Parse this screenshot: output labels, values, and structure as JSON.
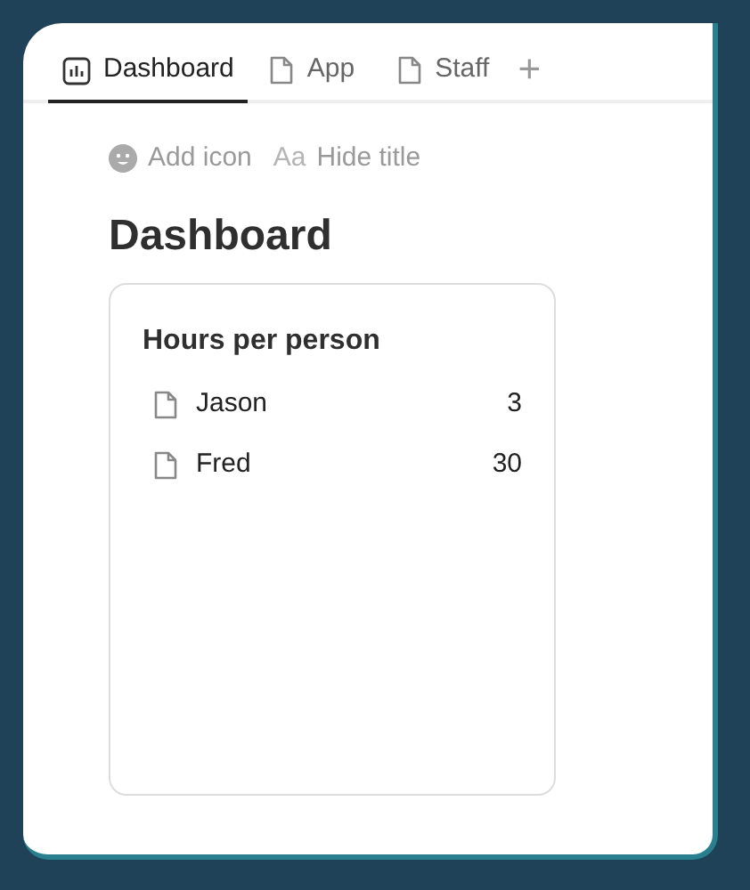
{
  "tabs": [
    {
      "label": "Dashboard",
      "kind": "dashboard",
      "selected": true
    },
    {
      "label": "App",
      "kind": "page",
      "selected": false
    },
    {
      "label": "Staff",
      "kind": "page",
      "selected": false
    }
  ],
  "add_tab": "+",
  "page_actions": [
    {
      "label": "Add icon",
      "kind": "emoji"
    },
    {
      "label": "Hide title",
      "kind": "text",
      "glyph": "Aa"
    }
  ],
  "title": "Dashboard",
  "card": {
    "title": "Hours per person",
    "rows": [
      {
        "name": "Jason",
        "value": "3"
      },
      {
        "name": "Fred",
        "value": "30"
      }
    ]
  }
}
